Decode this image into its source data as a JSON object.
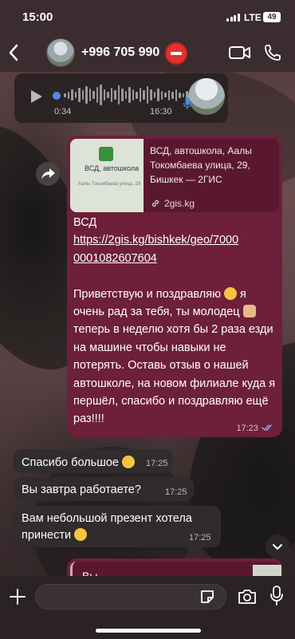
{
  "status_bar": {
    "time": "15:00",
    "network": "LTE",
    "battery": "49"
  },
  "header": {
    "contact_name": "+996 705 990",
    "back_icon": "chevron-left-icon",
    "video_icon": "video-camera-icon",
    "call_icon": "phone-icon",
    "badge_icon": "blocked-badge-icon"
  },
  "voice_message": {
    "duration": "0:34",
    "time": "16:30"
  },
  "outgoing_message": {
    "preview": {
      "title": "ВСД, автошкола, Аалы Токомбаева улица, 29, Бишкек — 2ГИС",
      "domain": "2gis.kg",
      "thumb_title": "ВСД, автошкола",
      "thumb_address": "Аалы Токомбаева улица, 29"
    },
    "line1": "ВСД",
    "link": "https://2gis.kg/bishkek/geo/70000001082607604",
    "body_part1": "Приветствую и поздравляю",
    "body_part2": " я очень рад за тебя, ты молодец",
    "body_part3": " теперь в неделю хотя бы 2 раза езди на машине чтобы навыки не потерять. Оставь отзыв о нашей автошколе, на новом филиале куда я першёл, спасибо и поздравляю ещё раз!!!!",
    "time": "17:23",
    "status_icon": "double-check-icon"
  },
  "incoming_messages": [
    {
      "text": "Спасибо большое",
      "time": "17:25"
    },
    {
      "text": "Вы завтра работаете?",
      "time": "17:25"
    },
    {
      "text_line1": "Вам небольшой презент хотела",
      "text_line2": "принести",
      "time": "17:25"
    }
  ],
  "partial_message": {
    "text": "Вы"
  },
  "input_bar": {
    "placeholder": ""
  },
  "colors": {
    "outgoing_bubble": "#6e1f3a",
    "incoming_bubble": "#302c2d",
    "link_accent": "#4a90e2",
    "block_badge": "#e0332e"
  }
}
